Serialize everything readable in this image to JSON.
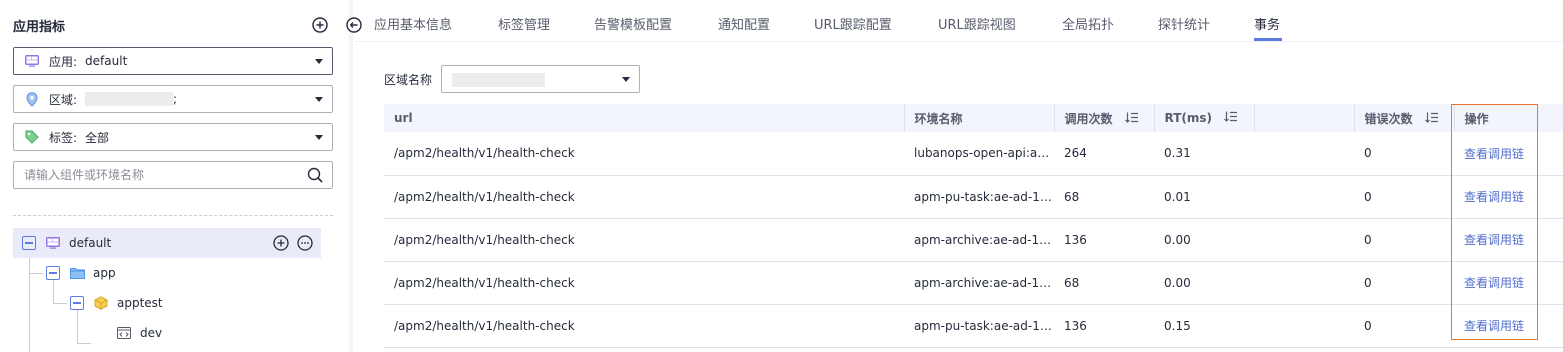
{
  "sidebar": {
    "title": "应用指标",
    "filters": {
      "app": {
        "label": "应用:",
        "value": "default"
      },
      "region": {
        "label": "区域:",
        "value_suffix": ";"
      },
      "tags": {
        "label": "标签:",
        "value": "全部"
      }
    },
    "search": {
      "placeholder": "请输入组件或环境名称",
      "value": ""
    },
    "tree": [
      {
        "label": "default",
        "icon": "app-icon",
        "selected": true
      },
      {
        "label": "app",
        "icon": "folder-icon"
      },
      {
        "label": "apptest",
        "icon": "component-icon"
      },
      {
        "label": "dev",
        "icon": "environment-icon"
      }
    ]
  },
  "tabs": [
    {
      "label": "应用基本信息"
    },
    {
      "label": "标签管理"
    },
    {
      "label": "告警模板配置"
    },
    {
      "label": "通知配置"
    },
    {
      "label": "URL跟踪配置"
    },
    {
      "label": "URL跟踪视图"
    },
    {
      "label": "全局拓扑"
    },
    {
      "label": "探针统计"
    },
    {
      "label": "事务",
      "active": true
    }
  ],
  "region_filter": {
    "label": "区域名称"
  },
  "table": {
    "columns": [
      "url",
      "环境名称",
      "调用次数",
      "RT(ms)",
      "",
      "错误次数",
      "操作"
    ],
    "rows": [
      {
        "url": "/apm2/health/v1/health-check",
        "env": "lubanops-open-api:ae...",
        "calls": "264",
        "rt": "0.31",
        "errors": "0",
        "action": "查看调用链"
      },
      {
        "url": "/apm2/health/v1/health-check",
        "env": "apm-pu-task:ae-ad-1-...",
        "calls": "68",
        "rt": "0.01",
        "errors": "0",
        "action": "查看调用链"
      },
      {
        "url": "/apm2/health/v1/health-check",
        "env": "apm-archive:ae-ad-1-...",
        "calls": "136",
        "rt": "0.00",
        "errors": "0",
        "action": "查看调用链"
      },
      {
        "url": "/apm2/health/v1/health-check",
        "env": "apm-archive:ae-ad-1-...",
        "calls": "68",
        "rt": "0.00",
        "errors": "0",
        "action": "查看调用链"
      },
      {
        "url": "/apm2/health/v1/health-check",
        "env": "apm-pu-task:ae-ad-1-...",
        "calls": "136",
        "rt": "0.15",
        "errors": "0",
        "action": "查看调用链"
      }
    ]
  },
  "colors": {
    "accent": "#5e7ce0",
    "link": "#526ecc",
    "highlight": "#e6772e",
    "header_bg": "#f2f5fc"
  }
}
